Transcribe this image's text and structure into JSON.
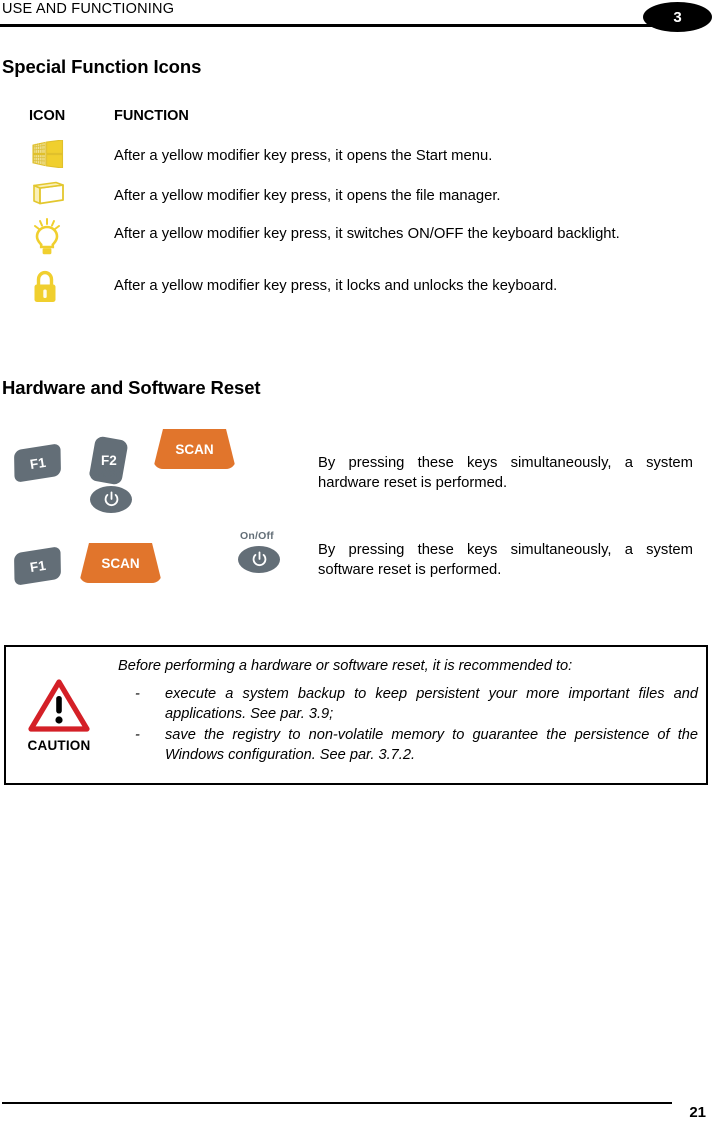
{
  "header": {
    "title": "USE AND FUNCTIONING",
    "chapter_number": "3"
  },
  "sections": {
    "special_function_icons": {
      "heading": "Special Function Icons",
      "table": {
        "columns": [
          "ICON",
          "FUNCTION"
        ],
        "rows": [
          {
            "icon": "windows-logo-icon",
            "function": "After a yellow modifier key press, it opens the Start menu."
          },
          {
            "icon": "folder-icon",
            "function": "After a yellow modifier key press, it opens the file manager."
          },
          {
            "icon": "light-bulb-icon",
            "function": "After a yellow modifier key press, it switches ON/OFF the keyboard backlight."
          },
          {
            "icon": "padlock-icon",
            "function": "After a yellow modifier key press, it locks and unlocks the keyboard."
          }
        ]
      }
    },
    "hardware_software_reset": {
      "heading": "Hardware and Software Reset",
      "rows": [
        {
          "keys": [
            "F1",
            "F2",
            "On/Off",
            "SCAN"
          ],
          "description": "By pressing these keys simultaneously, a system hardware reset is performed."
        },
        {
          "keys": [
            "F1",
            "SCAN",
            "On/Off"
          ],
          "description": "By pressing these keys simultaneously, a system software reset is performed."
        }
      ]
    }
  },
  "caution": {
    "label": "CAUTION",
    "icon": "warning-triangle-icon",
    "intro": "Before performing a hardware or software reset, it is recommended to:",
    "bullet_marker": "-",
    "items": [
      "execute a system backup to keep persistent your more important files and applications. See par. 3.9;",
      "save the registry to non-volatile memory to guarantee the persistence of the Windows configuration. See par. 3.7.2."
    ]
  },
  "footer": {
    "page_number": "21"
  },
  "colors": {
    "key_gray": "#636e77",
    "scan_orange": "#e1752c",
    "icon_yellow": "#efd23c",
    "caution_red": "#d42027",
    "rule_black": "#000000"
  }
}
